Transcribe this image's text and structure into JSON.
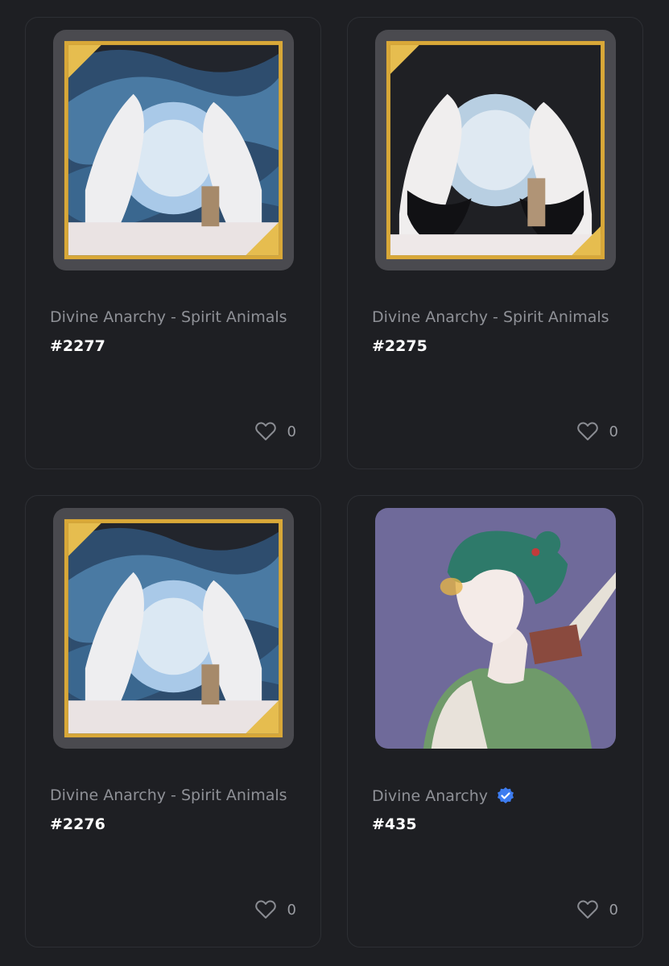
{
  "cards": [
    {
      "collection": "Divine Anarchy - Spirit Animals",
      "verified": false,
      "token": "#2277",
      "likes": "0",
      "art": "spirit-orb-blue-mist"
    },
    {
      "collection": "Divine Anarchy - Spirit Animals",
      "verified": false,
      "token": "#2275",
      "likes": "0",
      "art": "spirit-orb-dark"
    },
    {
      "collection": "Divine Anarchy - Spirit Animals",
      "verified": false,
      "token": "#2276",
      "likes": "0",
      "art": "spirit-orb-blue-mist"
    },
    {
      "collection": "Divine Anarchy",
      "verified": true,
      "token": "#435",
      "likes": "0",
      "art": "green-haired-character"
    }
  ],
  "icons": {
    "like": "heart-icon",
    "verified": "verified-badge-icon"
  },
  "colors": {
    "background": "#1e1f23",
    "card_border": "#2d2f34",
    "collection_text": "#8f9197",
    "token_text": "#ffffff",
    "verified_blue": "#3d7cf0",
    "gold_frame": "#d9a838"
  }
}
